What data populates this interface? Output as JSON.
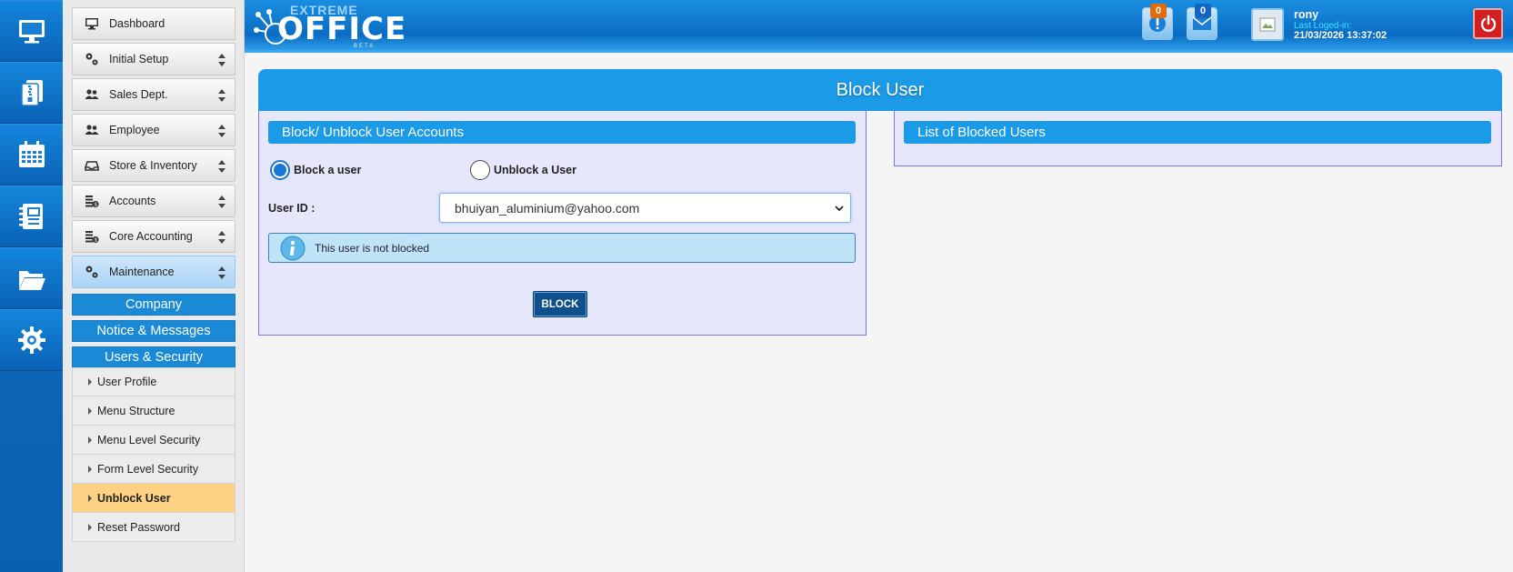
{
  "app": {
    "logo_top": "EXTREME",
    "logo_main": "OFFICE",
    "logo_sub": "BETA"
  },
  "rail": {
    "items": [
      {
        "icon": "monitor-icon"
      },
      {
        "icon": "document-zip-icon"
      },
      {
        "icon": "calendar-icon"
      },
      {
        "icon": "notebook-icon"
      },
      {
        "icon": "folder-open-icon"
      },
      {
        "icon": "gear-icon"
      }
    ]
  },
  "menu": {
    "dashboard": "Dashboard",
    "initial_setup": "Initial Setup",
    "sales_dept": "Sales Dept.",
    "employee": "Employee",
    "store_inventory": "Store & Inventory",
    "accounts": "Accounts",
    "core_accounting": "Core Accounting",
    "maintenance": "Maintenance",
    "company": "Company",
    "notice_messages": "Notice & Messages",
    "users_security": "Users & Security",
    "sub_items": [
      "User Profile",
      "Menu Structure",
      "Menu Level Security",
      "Form Level Security",
      "Unblock User",
      "Reset Password"
    ],
    "selected_sub": "Unblock User"
  },
  "header": {
    "alerts_count": "0",
    "messages_count": "0",
    "user_name": "rony",
    "last_logged_label": "Last Loged-in:",
    "last_logged_value": "21/03/2026 13:37:02",
    "colors": {
      "alert_badge": "#e36c0a",
      "message_badge": "#1565c0",
      "power": "#d31f1f"
    }
  },
  "page": {
    "title": "Block User",
    "left_panel_title": "Block/ Unblock User Accounts",
    "right_panel_title": "List of Blocked Users",
    "radio_block": "Block a user",
    "radio_unblock": "Unblock a User",
    "selected_radio": "Block a user",
    "user_id_label": "User ID :",
    "user_id_value": "bhuiyan_aluminium@yahoo.com",
    "info_message": "This user is not blocked",
    "block_button": "BLOCK",
    "accent_color": "#1b9ae8"
  }
}
